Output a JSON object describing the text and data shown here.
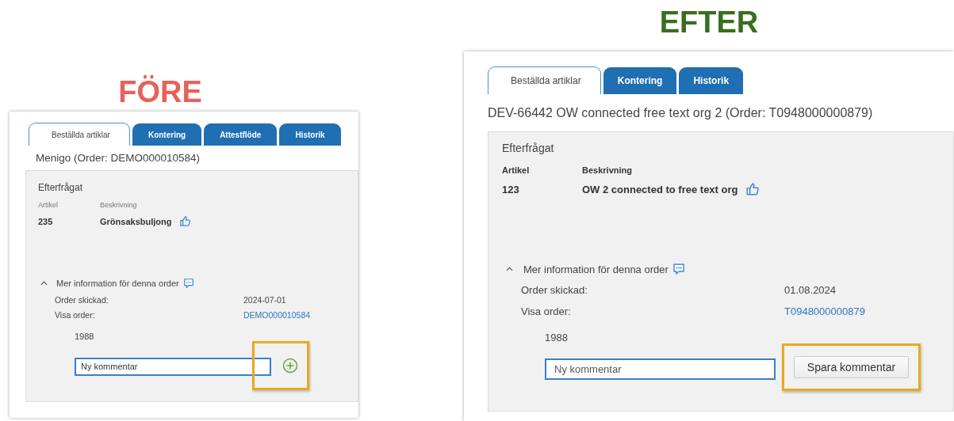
{
  "comparisons": [
    {
      "heading": "FÖRE",
      "color": "#e8605a",
      "tabs": [
        {
          "label": "Beställda artiklar",
          "selected": true
        },
        {
          "label": "Kontering",
          "selected": false
        },
        {
          "label": "Attestflöde",
          "selected": false
        },
        {
          "label": "Historik",
          "selected": false
        }
      ],
      "title": "Menigo (Order: DEMO000010584)",
      "section": "Efterfrågat",
      "article_label": "Artikel",
      "description_label": "Beskrivning",
      "article": "235",
      "description": "Grönsaksbuljong",
      "more_info": {
        "label": "Mer information för denna order",
        "expanded": true
      },
      "rows": [
        {
          "label": "Order skickad:",
          "value": "2024-07-01",
          "kind": "text"
        },
        {
          "label": "Visa order:",
          "value": "DEMO000010584",
          "kind": "link"
        }
      ],
      "comment": {
        "label": "1988",
        "value": "Ny kommentar"
      },
      "action": {
        "kind": "icon",
        "highlighted": true
      }
    },
    {
      "heading": "EFTER",
      "color": "#3a6e1f",
      "tabs": [
        {
          "label": "Beställda artiklar",
          "selected": true
        },
        {
          "label": "Kontering",
          "selected": false
        },
        {
          "label": "Historik",
          "selected": false
        }
      ],
      "title": "DEV-66442 OW connected free text org 2 (Order: T0948000000879)",
      "section": "Efterfrågat",
      "article_label": "Artikel",
      "description_label": "Beskrivning",
      "article": "123",
      "description": "OW 2 connected to free text org",
      "more_info": {
        "label": "Mer information för denna order",
        "expanded": true
      },
      "rows": [
        {
          "label": "Order skickad:",
          "value": "01.08.2024",
          "kind": "text"
        },
        {
          "label": "Visa order:",
          "value": "T0948000000879",
          "kind": "link"
        }
      ],
      "comment": {
        "label": "1988",
        "placeholder": "Ny kommentar"
      },
      "action": {
        "kind": "button",
        "label": "Spara kommentar",
        "highlighted": true
      }
    }
  ]
}
